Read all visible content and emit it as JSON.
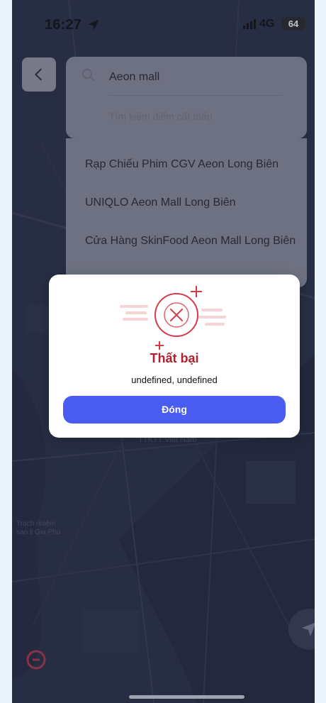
{
  "status_bar": {
    "time": "16:27",
    "network": "4G",
    "battery": "64"
  },
  "search": {
    "value": "Aeon mall",
    "placeholder": "Tìm kiếm điểm cất thấp"
  },
  "results": [
    {
      "label": "Rạp Chiếu Phim CGV Aeon Long Biên"
    },
    {
      "label": "UNIQLO Aeon Mall Long Biên"
    },
    {
      "label": "Cửa Hàng SkinFood Aeon Mall Long Biên"
    }
  ],
  "dialog": {
    "title": "Thất bại",
    "message": "undefined, undefined",
    "button_label": "Đóng"
  },
  "map_labels": {
    "label_center": "TTKTT Việt Nam",
    "label_left_line1": "Trạch nhiệm",
    "label_left_line2": "sao li Gia Phú"
  },
  "colors": {
    "accent": "#4b5cf2",
    "error": "#b0202c",
    "overlay": "#2f3448"
  },
  "icons": {
    "back": "chevron-left-icon",
    "search": "search-icon",
    "error": "close-circle-icon",
    "locate": "navigation-arrow-icon"
  }
}
